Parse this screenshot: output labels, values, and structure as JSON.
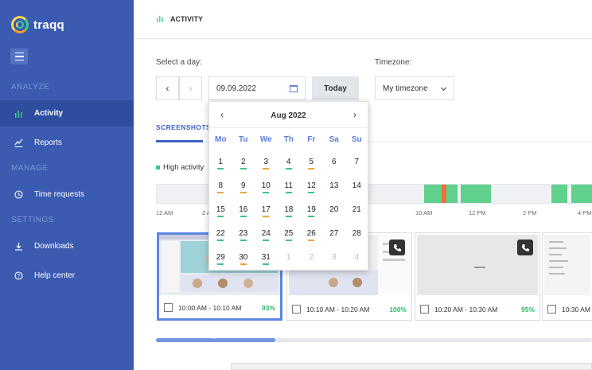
{
  "app": {
    "name": "traqq"
  },
  "sidebar": {
    "sections": [
      {
        "label": "ANALYZE"
      },
      {
        "label": "MANAGE"
      },
      {
        "label": "SETTINGS"
      }
    ],
    "items": [
      {
        "label": "Activity",
        "icon": "bar-chart-icon",
        "active": true
      },
      {
        "label": "Reports",
        "icon": "line-chart-icon"
      },
      {
        "label": "Time requests",
        "icon": "clock-icon"
      },
      {
        "label": "Downloads",
        "icon": "download-icon"
      },
      {
        "label": "Help center",
        "icon": "help-icon"
      }
    ]
  },
  "header": {
    "title": "ACTIVITY"
  },
  "filters": {
    "day_label": "Select a day:",
    "date_value": "09.09.2022",
    "today_label": "Today",
    "timezone_label": "Timezone:",
    "timezone_value": "My timezone",
    "prev": "‹",
    "next": "›"
  },
  "tabs": {
    "screenshots": "SCREENSHOTS"
  },
  "legend": {
    "high": "High activity"
  },
  "timeline": {
    "ticks": [
      "12 AM",
      "2 A",
      "10 AM",
      "12 PM",
      "2 PM",
      "4 PM"
    ]
  },
  "calendar": {
    "month": "Aug 2022",
    "prev": "‹",
    "next": "›",
    "weekdays": [
      "Mo",
      "Tu",
      "We",
      "Th",
      "Fr",
      "Sa",
      "Su"
    ],
    "weeks": [
      [
        {
          "d": "1",
          "u": "g"
        },
        {
          "d": "2",
          "u": "g"
        },
        {
          "d": "3",
          "u": "o"
        },
        {
          "d": "4",
          "u": "g"
        },
        {
          "d": "5",
          "u": "o"
        },
        {
          "d": "6"
        },
        {
          "d": "7"
        }
      ],
      [
        {
          "d": "8",
          "u": "o"
        },
        {
          "d": "9",
          "u": "o"
        },
        {
          "d": "10",
          "u": "g"
        },
        {
          "d": "11",
          "u": "g"
        },
        {
          "d": "12",
          "u": "g"
        },
        {
          "d": "13"
        },
        {
          "d": "14"
        }
      ],
      [
        {
          "d": "15",
          "u": "g"
        },
        {
          "d": "16",
          "u": "g"
        },
        {
          "d": "17",
          "u": "o"
        },
        {
          "d": "18",
          "u": "g"
        },
        {
          "d": "19",
          "u": "g"
        },
        {
          "d": "20"
        },
        {
          "d": "21"
        }
      ],
      [
        {
          "d": "22",
          "u": "g"
        },
        {
          "d": "23",
          "u": "g"
        },
        {
          "d": "24",
          "u": "g"
        },
        {
          "d": "25",
          "u": "g"
        },
        {
          "d": "26",
          "u": "o"
        },
        {
          "d": "27"
        },
        {
          "d": "28"
        }
      ],
      [
        {
          "d": "29",
          "u": "g"
        },
        {
          "d": "30",
          "u": "o"
        },
        {
          "d": "31",
          "u": "g"
        },
        {
          "d": "1",
          "m": true
        },
        {
          "d": "2",
          "m": true
        },
        {
          "d": "3",
          "m": true
        },
        {
          "d": "4",
          "m": true
        }
      ]
    ]
  },
  "screenshots": [
    {
      "time": "10:00 AM - 10:10 AM",
      "percent": "93%",
      "selected": true
    },
    {
      "time": "10:10 AM - 10:20 AM",
      "percent": "100%",
      "call": true
    },
    {
      "time": "10:20 AM - 10:30 AM",
      "percent": "95%",
      "call": true
    },
    {
      "time": "10:30 AM",
      "percent": ""
    }
  ],
  "scrollbar_label": "III",
  "colors": {
    "sidebar": "#3b5bb1",
    "accent": "#3b63c9",
    "high": "#5fd18c",
    "warn": "#f2a33a"
  }
}
